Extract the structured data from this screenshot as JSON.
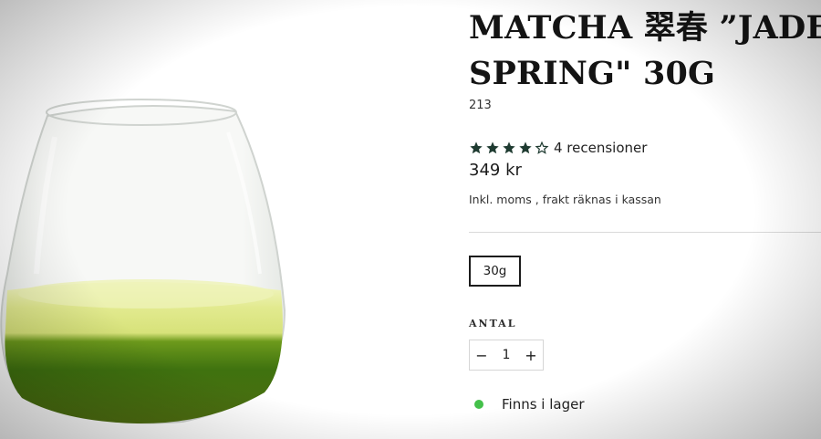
{
  "product": {
    "title": "MATCHA 翠春 ”JADE\nSPRING\" 30G",
    "sku": "213",
    "rating": {
      "stars_filled": 4,
      "stars_total": 5,
      "review_text": "4 recensioner"
    },
    "price": "349 kr",
    "tax_note": "Inkl. moms , frakt räknas i kassan",
    "variants": [
      {
        "label": "30g",
        "selected": true
      }
    ],
    "quantity": {
      "label": "ANTAL",
      "value": "1",
      "minus_symbol": "−",
      "plus_symbol": "+"
    },
    "stock": {
      "text": "Finns i lager",
      "dot_color": "#44c04a"
    }
  },
  "colors": {
    "star": "#1f3b31",
    "text": "#1c1c1c",
    "matcha_light": "#dde79a",
    "matcha_dark": "#3e6f12"
  },
  "image": {
    "subject": "glass-of-matcha-icon"
  }
}
